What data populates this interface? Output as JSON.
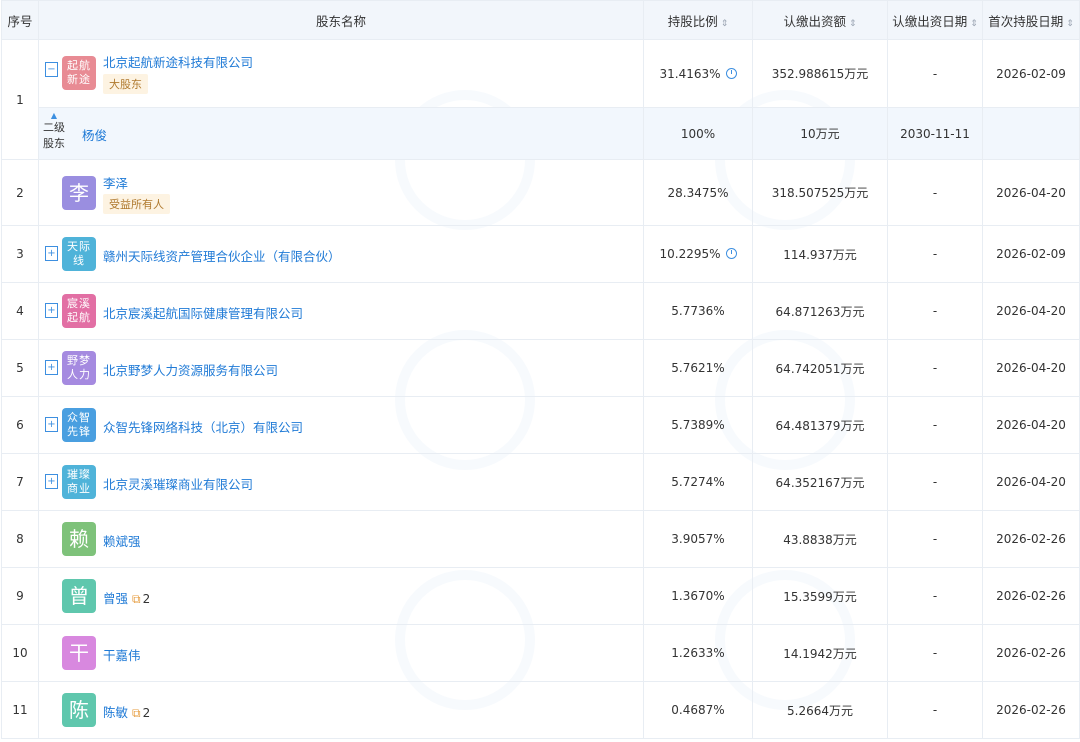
{
  "headers": {
    "idx": "序号",
    "name": "股东名称",
    "ratio": "持股比例",
    "capital": "认缴出资额",
    "date": "认缴出资日期",
    "first": "首次持股日期"
  },
  "sort_icon": "⇕",
  "rows": [
    {
      "idx": "1",
      "logo": "起航\n新途",
      "name": "北京起航新途科技有限公司",
      "tag": "大股东",
      "ratio": "31.4163%",
      "capital": "352.988615万元",
      "date": "-",
      "first": "2026-02-09",
      "expand": "−"
    },
    {
      "sub_label": "二级\n股东",
      "name": "杨俊",
      "ratio": "100%",
      "capital": "10万元",
      "date": "2030-11-11",
      "first": ""
    },
    {
      "idx": "2",
      "avatar": "李",
      "name": "李泽",
      "tag": "受益所有人",
      "ratio": "28.3475%",
      "capital": "318.507525万元",
      "date": "-",
      "first": "2026-04-20"
    },
    {
      "idx": "3",
      "logo": "天际\n线",
      "name": "赣州天际线资产管理合伙企业（有限合伙）",
      "ratio": "10.2295%",
      "capital": "114.937万元",
      "date": "-",
      "first": "2026-02-09",
      "expand": "+"
    },
    {
      "idx": "4",
      "logo": "宸溪\n起航",
      "name": "北京宸溪起航国际健康管理有限公司",
      "ratio": "5.7736%",
      "capital": "64.871263万元",
      "date": "-",
      "first": "2026-04-20",
      "expand": "+"
    },
    {
      "idx": "5",
      "logo": "野梦\n人力",
      "name": "北京野梦人力资源服务有限公司",
      "ratio": "5.7621%",
      "capital": "64.742051万元",
      "date": "-",
      "first": "2026-04-20",
      "expand": "+"
    },
    {
      "idx": "6",
      "logo": "众智\n先锋",
      "name": "众智先锋网络科技（北京）有限公司",
      "ratio": "5.7389%",
      "capital": "64.481379万元",
      "date": "-",
      "first": "2026-04-20",
      "expand": "+"
    },
    {
      "idx": "7",
      "logo": "璀璨\n商业",
      "name": "北京灵溪璀璨商业有限公司",
      "ratio": "5.7274%",
      "capital": "64.352167万元",
      "date": "-",
      "first": "2026-04-20",
      "expand": "+"
    },
    {
      "idx": "8",
      "avatar": "赖",
      "name": "赖斌强",
      "ratio": "3.9057%",
      "capital": "43.8838万元",
      "date": "-",
      "first": "2026-02-26"
    },
    {
      "idx": "9",
      "avatar": "曾",
      "name": "曾强",
      "link_count": "2",
      "ratio": "1.3670%",
      "capital": "15.3599万元",
      "date": "-",
      "first": "2026-02-26"
    },
    {
      "idx": "10",
      "avatar": "干",
      "name": "干嘉伟",
      "ratio": "1.2633%",
      "capital": "14.1942万元",
      "date": "-",
      "first": "2026-02-26"
    },
    {
      "idx": "11",
      "avatar": "陈",
      "name": "陈敏",
      "link_count": "2",
      "ratio": "0.4687%",
      "capital": "5.2664万元",
      "date": "-",
      "first": "2026-02-26"
    }
  ],
  "colors": {
    "logo_1": "#e88b94",
    "logo_3": "#4fb3d9",
    "logo_4": "#e26fa4",
    "logo_5": "#a58ae0",
    "logo_6": "#4a9fe0",
    "logo_7": "#4fb3d9",
    "avatar_2": "#9a8ee0",
    "avatar_8": "#7ec27a",
    "avatar_9": "#5fc7ad",
    "avatar_10": "#d888df",
    "avatar_11": "#5fc7ad"
  },
  "icons": {
    "pie": "pie-chart-icon",
    "link": "relation-link-icon",
    "expand": "expand-icon",
    "sort": "sort-icon"
  }
}
